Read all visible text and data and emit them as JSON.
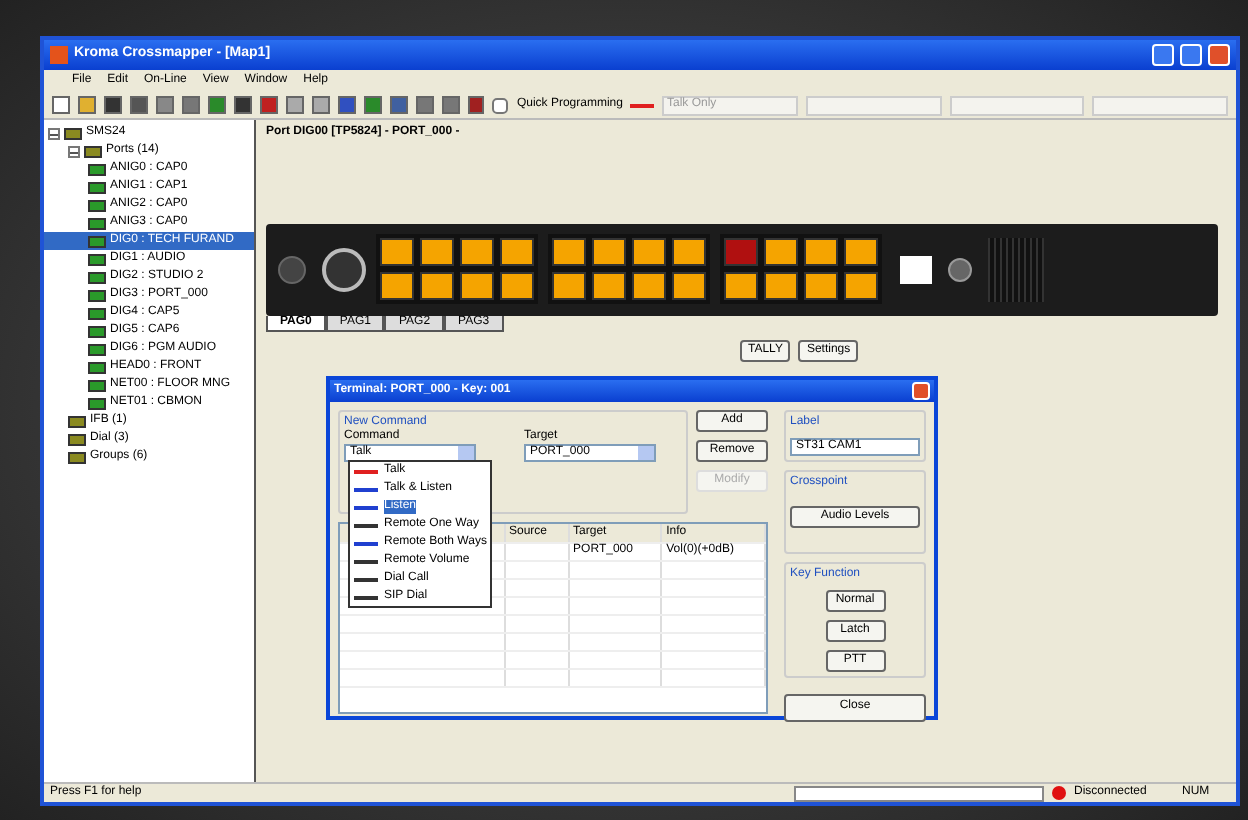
{
  "window": {
    "title": "Kroma Crossmapper - [Map1]"
  },
  "menu": [
    "File",
    "Edit",
    "On-Line",
    "View",
    "Window",
    "Help"
  ],
  "toolbar": {
    "quick_programming": {
      "label": "Quick Programming",
      "checked": false
    },
    "combos": [
      "Talk Only"
    ]
  },
  "tree": [
    {
      "label": "SMS24",
      "expanded": true,
      "children": [
        {
          "label": "Ports (14)",
          "expanded": true,
          "children": [
            {
              "label": "ANIG0 : CAP0",
              "selected": false
            },
            {
              "label": "ANIG1 : CAP1",
              "selected": false
            },
            {
              "label": "ANIG2 : CAP0",
              "selected": false
            },
            {
              "label": "ANIG3 : CAP0",
              "selected": false
            },
            {
              "label": "DIG0 : TECH FURAND",
              "selected": true
            },
            {
              "label": "DIG1 : AUDIO",
              "selected": false
            },
            {
              "label": "DIG2 : STUDIO 2",
              "selected": false
            },
            {
              "label": "DIG3 : PORT_000",
              "selected": false
            },
            {
              "label": "DIG4 : CAP5",
              "selected": false
            },
            {
              "label": "DIG5 : CAP6",
              "selected": false
            },
            {
              "label": "DIG6 : PGM AUDIO",
              "selected": false
            },
            {
              "label": "HEAD0 : FRONT",
              "selected": false
            },
            {
              "label": "NET00 : FLOOR MNG",
              "selected": false
            },
            {
              "label": "NET01 : CBMON",
              "selected": false
            }
          ]
        },
        {
          "label": "IFB (1)",
          "selected": false
        },
        {
          "label": "Dial (3)",
          "selected": false
        },
        {
          "label": "Groups (6)",
          "selected": false
        }
      ]
    }
  ],
  "port_title": "Port DIG00 [TP5824] - PORT_000 -",
  "panel": {
    "key_groups": [
      [
        {
          "color": "#f5a400"
        },
        {
          "color": "#f5a400"
        },
        {
          "color": "#f5a400"
        },
        {
          "color": "#f5a400"
        },
        {
          "color": "#f5a400"
        },
        {
          "color": "#f5a400"
        },
        {
          "color": "#f5a400"
        },
        {
          "color": "#f5a400"
        }
      ],
      [
        {
          "color": "#f5a400"
        },
        {
          "color": "#f5a400"
        },
        {
          "color": "#f5a400"
        },
        {
          "color": "#f5a400"
        },
        {
          "color": "#f5a400"
        },
        {
          "color": "#f5a400"
        },
        {
          "color": "#f5a400"
        },
        {
          "color": "#f5a400"
        }
      ],
      [
        {
          "color": "#b01010"
        },
        {
          "color": "#f5a400"
        },
        {
          "color": "#f5a400"
        },
        {
          "color": "#f5a400"
        },
        {
          "color": "#f5a400"
        },
        {
          "color": "#f5a400"
        },
        {
          "color": "#f5a400"
        },
        {
          "color": "#f5a400"
        }
      ]
    ]
  },
  "pages": [
    {
      "label": "PAG0",
      "selected": true
    },
    {
      "label": "PAG1",
      "selected": false
    },
    {
      "label": "PAG2",
      "selected": false
    },
    {
      "label": "PAG3",
      "selected": false
    }
  ],
  "panel_buttons": [
    "TALLY",
    "Settings"
  ],
  "dialog": {
    "title": "Terminal: PORT_000 - Key: 001",
    "new_command": {
      "group": "New Command",
      "command_label": "Command",
      "command_value": "Talk",
      "target_label": "Target",
      "target_value": "PORT_000"
    },
    "command_options": [
      {
        "label": "Talk",
        "selected": false
      },
      {
        "label": "Talk & Listen",
        "selected": false
      },
      {
        "label": "Listen",
        "selected": true
      },
      {
        "label": "Remote One Way",
        "selected": false
      },
      {
        "label": "Remote Both Ways",
        "selected": false
      },
      {
        "label": "Remote Volume",
        "selected": false
      },
      {
        "label": "Dial Call",
        "selected": false
      },
      {
        "label": "SIP Dial",
        "selected": false
      }
    ],
    "buttons": [
      {
        "label": "Add",
        "disabled": false
      },
      {
        "label": "Remove",
        "disabled": false
      },
      {
        "label": "Modify",
        "disabled": true
      }
    ],
    "label_group": {
      "title": "Label",
      "value": "ST31 CAM1"
    },
    "crosspoint": {
      "title": "Crosspoint",
      "button": "Audio Levels"
    },
    "key_function": {
      "title": "Key Function",
      "buttons": [
        "Normal",
        "Latch",
        "PTT"
      ]
    },
    "table": {
      "columns": [
        "Source",
        "Target",
        "Info"
      ],
      "rows": [
        [
          "",
          "PORT_000",
          "Vol(0)(+0dB)"
        ]
      ]
    },
    "close": "Close"
  },
  "status_bar": {
    "help": "Press F1 for help",
    "connection": "Disconnected",
    "num": "NUM"
  }
}
